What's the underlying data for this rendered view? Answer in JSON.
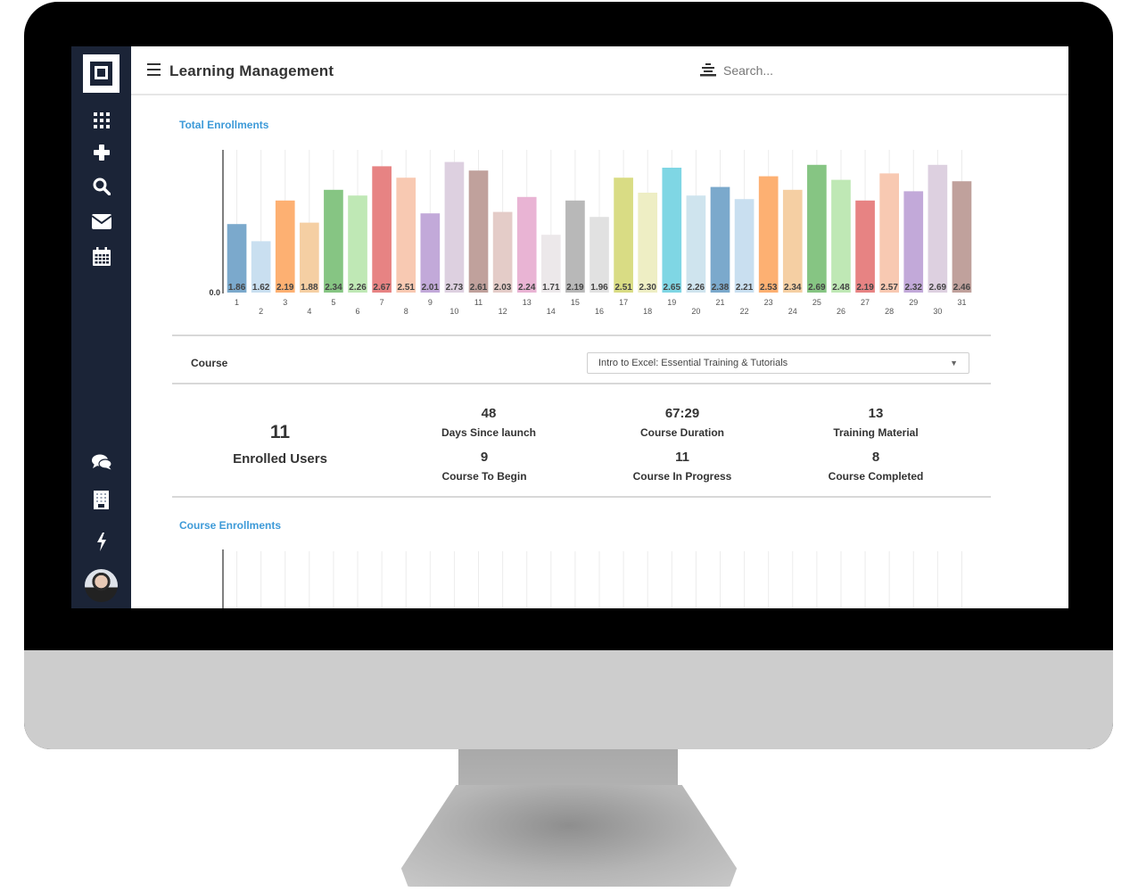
{
  "app": {
    "title": "Learning Management",
    "search_placeholder": "Search..."
  },
  "sidebar": {
    "logo": "app-logo",
    "top_items": [
      {
        "name": "apps-grid",
        "icon": "grid-icon"
      },
      {
        "name": "add",
        "icon": "plus-icon"
      },
      {
        "name": "search",
        "icon": "search-icon"
      },
      {
        "name": "mail",
        "icon": "envelope-icon"
      },
      {
        "name": "calendar",
        "icon": "calendar-icon"
      }
    ],
    "bottom_items": [
      {
        "name": "chat",
        "icon": "chat-bubbles-icon"
      },
      {
        "name": "building",
        "icon": "building-icon"
      },
      {
        "name": "activity",
        "icon": "lightning-icon"
      },
      {
        "name": "profile",
        "icon": "user-avatar"
      }
    ]
  },
  "sections": {
    "total_enrollments": "Total Enrollments",
    "course_enrollments": "Course Enrollments"
  },
  "course_filter": {
    "label": "Course",
    "selected": "Intro to Excel: Essential Training & Tutorials"
  },
  "stats": {
    "enrolled_users": {
      "value": "11",
      "label": "Enrolled Users"
    },
    "days_since_launch": {
      "value": "48",
      "label": "Days Since launch"
    },
    "course_duration": {
      "value": "67:29",
      "label": "Course Duration"
    },
    "training_material": {
      "value": "13",
      "label": "Training Material"
    },
    "course_to_begin": {
      "value": "9",
      "label": "Course To Begin"
    },
    "course_in_progress": {
      "value": "11",
      "label": "Course In Progress"
    },
    "course_completed": {
      "value": "8",
      "label": "Course Completed"
    }
  },
  "chart_data": {
    "type": "bar",
    "title": "Total Enrollments",
    "xlabel": "",
    "ylabel": "",
    "y_tick_labels": [
      "0.0"
    ],
    "ylim": [
      0.9,
      2.9
    ],
    "grid": "vertical",
    "legend": "none",
    "categories": [
      "1",
      "2",
      "3",
      "4",
      "5",
      "6",
      "7",
      "8",
      "9",
      "10",
      "11",
      "12",
      "13",
      "14",
      "15",
      "16",
      "17",
      "18",
      "19",
      "20",
      "21",
      "22",
      "23",
      "24",
      "25",
      "26",
      "27",
      "28",
      "29",
      "30",
      "31"
    ],
    "values": [
      1.86,
      1.62,
      2.19,
      1.88,
      2.34,
      2.26,
      2.67,
      2.51,
      2.01,
      2.73,
      2.61,
      2.03,
      2.24,
      1.71,
      2.19,
      1.96,
      2.51,
      2.3,
      2.65,
      2.26,
      2.38,
      2.21,
      2.53,
      2.34,
      2.69,
      2.48,
      2.19,
      2.57,
      2.32,
      2.69,
      2.46
    ],
    "colors": [
      "#7ba9cc",
      "#c9dff0",
      "#fdb072",
      "#f5cfa3",
      "#86c583",
      "#bfe8b5",
      "#e78383",
      "#f8c9b2",
      "#c2a9d9",
      "#ddd0e0",
      "#c0a19c",
      "#e4ccc8",
      "#e9b4d4",
      "#ece8ea",
      "#b8b8b8",
      "#e1e1e1",
      "#d9dc84",
      "#eeeec4",
      "#7fd6e4",
      "#cfe4ee",
      "#7ba9cc",
      "#c9dff0",
      "#fdb072",
      "#f5cfa3",
      "#86c583",
      "#bfe8b5",
      "#e78383",
      "#f8c9b2",
      "#c2a9d9",
      "#ddd0e0",
      "#c0a19c"
    ]
  },
  "bottom_chart": {
    "title": "Course Enrollments",
    "categories_visible": 31
  }
}
